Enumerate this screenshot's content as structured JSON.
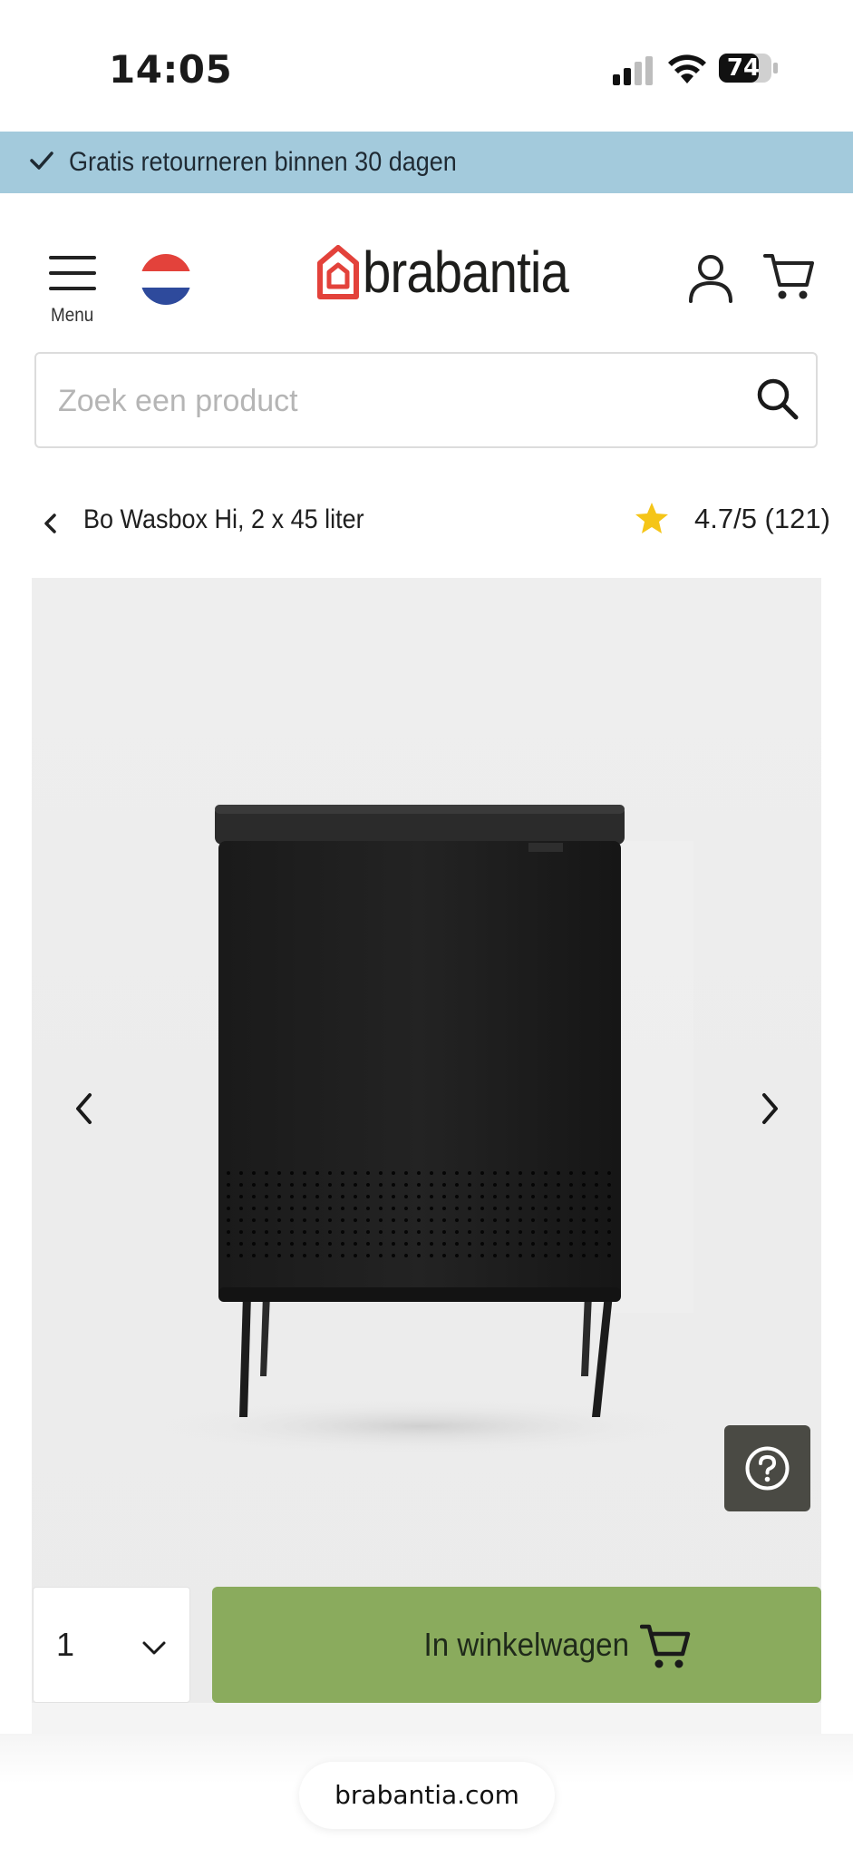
{
  "status_bar": {
    "time": "14:05",
    "battery": "74"
  },
  "promo": {
    "text": "Gratis retourneren binnen 30 dagen"
  },
  "header": {
    "menu_label": "Menu",
    "logo_text": "brabantia"
  },
  "search": {
    "placeholder": "Zoek een product"
  },
  "product": {
    "title": "Bo Wasbox Hi, 2 x 45 liter",
    "rating": "4.7/5 (121)"
  },
  "cart_bar": {
    "quantity": "1",
    "add_label": "In winkelwagen"
  },
  "browser": {
    "url": "brabantia.com"
  },
  "colors": {
    "promo_bg": "#a3cadc",
    "cart_button": "#8aab5d",
    "logo_mark": "#e3423b",
    "star": "#f5c518",
    "help_button": "#4a4a44"
  },
  "icons": [
    "check-icon",
    "menu-icon",
    "nl-flag-icon",
    "account-icon",
    "cart-icon",
    "search-icon",
    "back-chevron-icon",
    "star-icon",
    "prev-chevron-icon",
    "next-chevron-icon",
    "help-icon",
    "chevron-down-icon"
  ]
}
